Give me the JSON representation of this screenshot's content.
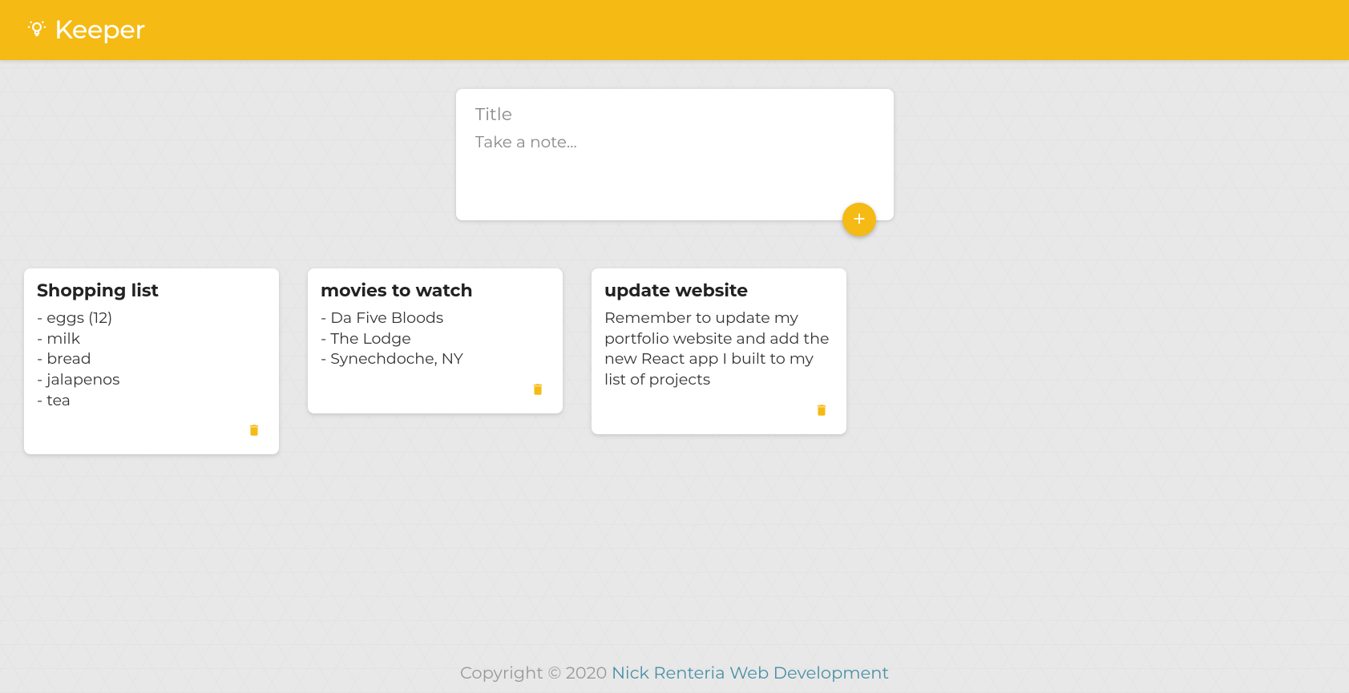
{
  "header": {
    "app_name": "Keeper"
  },
  "create_form": {
    "title_placeholder": "Title",
    "content_placeholder": "Take a note..."
  },
  "notes": [
    {
      "title": "Shopping list",
      "content": "- eggs (12)\n- milk\n- bread\n- jalapenos\n- tea"
    },
    {
      "title": "movies to watch",
      "content": "- Da Five Bloods\n- The Lodge\n- Synechdoche, NY"
    },
    {
      "title": "update website",
      "content": "Remember to update my portfolio website and add the new React app I built to my list of projects"
    }
  ],
  "footer": {
    "copyright_prefix": "Copyright © 2020 ",
    "link_text": "Nick Renteria Web Development"
  }
}
